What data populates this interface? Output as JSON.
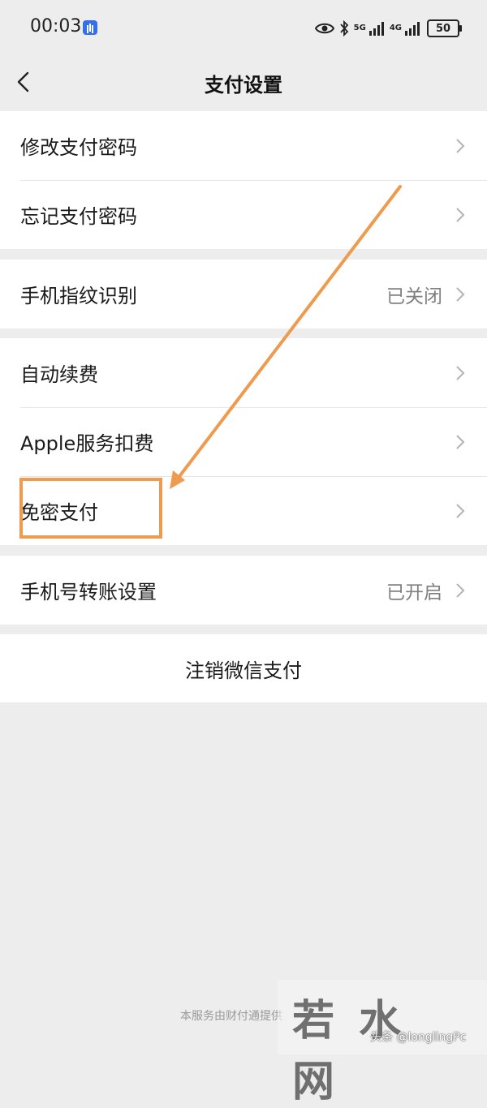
{
  "status_bar": {
    "time": "00:03",
    "network_1": "5G",
    "network_2": "4G",
    "battery": "50"
  },
  "nav": {
    "title": "支付设置"
  },
  "groups": [
    {
      "items": [
        {
          "label": "修改支付密码",
          "value": ""
        },
        {
          "label": "忘记支付密码",
          "value": ""
        }
      ]
    },
    {
      "items": [
        {
          "label": "手机指纹识别",
          "value": "已关闭"
        }
      ]
    },
    {
      "items": [
        {
          "label": "自动续费",
          "value": ""
        },
        {
          "label": "Apple服务扣费",
          "value": ""
        },
        {
          "label": "免密支付",
          "value": ""
        }
      ]
    },
    {
      "items": [
        {
          "label": "手机号转账设置",
          "value": "已开启"
        }
      ]
    }
  ],
  "logout": {
    "label": "注销微信支付"
  },
  "footer": {
    "text": "本服务由财付通提供"
  },
  "watermark": {
    "logo": "若水网",
    "handle": "头条 @longlingPc"
  },
  "colors": {
    "annotation": "#ef9b4f",
    "background": "#ededed",
    "card": "#ffffff",
    "secondary_text": "#808080"
  }
}
